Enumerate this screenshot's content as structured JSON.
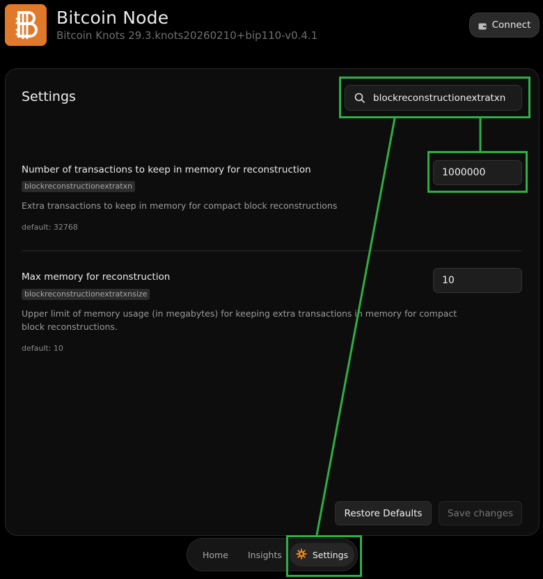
{
  "header": {
    "app_title": "Bitcoin Node",
    "app_subtitle": "Bitcoin Knots 29.3.knots20260210+bip110-v0.4.1",
    "connect_label": "Connect",
    "logo_icon": "bitcoin-knots-logo-icon",
    "brand_color": "#e07a2a"
  },
  "settings_panel": {
    "title": "Settings",
    "search": {
      "value": "blockreconstructionextratxn",
      "icon": "search-icon"
    },
    "items": [
      {
        "title": "Number of transactions to keep in memory for reconstruction",
        "key": "blockreconstructionextratxn",
        "description": "Extra transactions to keep in memory for compact block reconstructions",
        "default": "default: 32768",
        "value": "1000000"
      },
      {
        "title": "Max memory for reconstruction",
        "key": "blockreconstructionextratxnsize",
        "description": "Upper limit of memory usage (in megabytes) for keeping extra transactions in memory for compact block reconstructions.",
        "default": "default: 10",
        "value": "10"
      }
    ],
    "restore_label": "Restore Defaults",
    "save_label": "Save changes"
  },
  "bottom_nav": {
    "items": [
      {
        "label": "Home"
      },
      {
        "label": "Insights"
      },
      {
        "label": "Settings",
        "icon": "gear-icon",
        "active": true
      }
    ],
    "accent_color": "#e8831f"
  },
  "annotation": {
    "color": "#2db044"
  }
}
